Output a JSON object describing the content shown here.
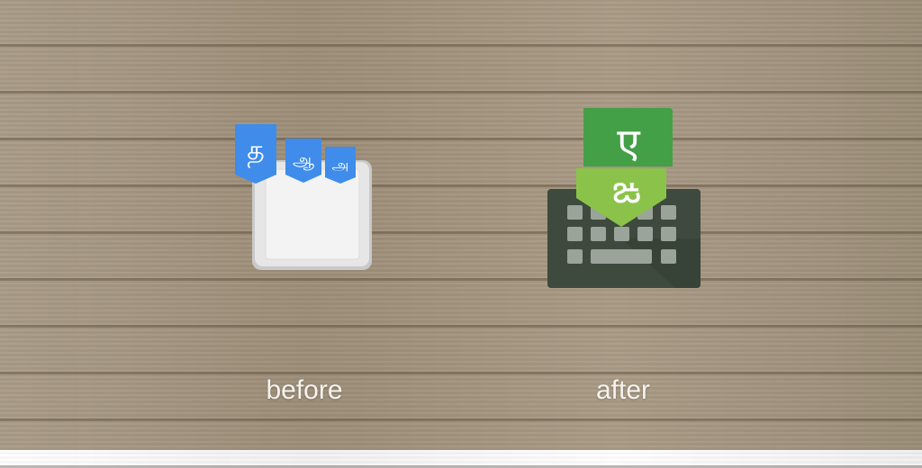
{
  "before": {
    "label": "before",
    "icon": "keyboard-icon-old",
    "tags": [
      "த",
      "ஆ",
      "அ"
    ],
    "tag_color": "#3f8cea"
  },
  "after": {
    "label": "after",
    "icon": "keyboard-icon-new",
    "glyph_top": "ए",
    "glyph_bottom": "ఙ",
    "colors": {
      "green_dark": "#43a047",
      "green_light": "#8bc34a",
      "keyboard": "#3e4a3e",
      "key": "#9aa49a"
    }
  }
}
